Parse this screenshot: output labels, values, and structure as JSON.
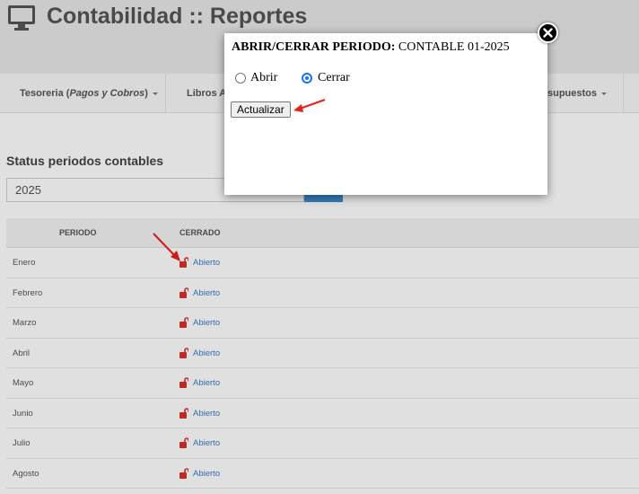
{
  "header": {
    "title": "Contabilidad :: Reportes",
    "icon": "monitor-icon"
  },
  "nav": {
    "items": [
      {
        "label": "Tesoreria (",
        "italic": "Pagos y Cobros",
        "suffix": ")"
      },
      {
        "label": "Libros A"
      },
      {
        "label": "supuestos"
      }
    ]
  },
  "main": {
    "section_title": "Status periodos contables",
    "year_value": "2025",
    "table": {
      "headers": [
        "PERIODO",
        "CERRADO"
      ],
      "rows": [
        {
          "month": "Enero",
          "status": "Abierto"
        },
        {
          "month": "Febrero",
          "status": "Abierto"
        },
        {
          "month": "Marzo",
          "status": "Abierto"
        },
        {
          "month": "Abril",
          "status": "Abierto"
        },
        {
          "month": "Mayo",
          "status": "Abierto"
        },
        {
          "month": "Junio",
          "status": "Abierto"
        },
        {
          "month": "Julio",
          "status": "Abierto"
        },
        {
          "month": "Agosto",
          "status": "Abierto"
        }
      ]
    }
  },
  "modal": {
    "title_bold": "ABRIR/CERRAR PERIODO:",
    "title_rest": " CONTABLE 01-2025",
    "radio_open": "Abrir",
    "radio_close": "Cerrar",
    "selected": "Cerrar",
    "button": "Actualizar"
  },
  "colors": {
    "accent": "#3b8fd6",
    "link": "#3a7bc8",
    "lock": "#d9312b",
    "arrow": "#e8201c"
  }
}
